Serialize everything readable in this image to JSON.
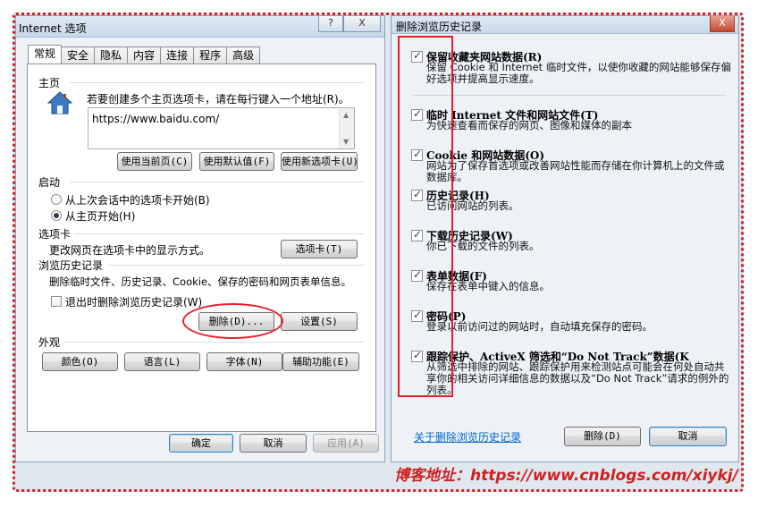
{
  "left": {
    "title": "Internet 选项",
    "help": "?",
    "close": "X",
    "tabs": [
      "常规",
      "安全",
      "隐私",
      "内容",
      "连接",
      "程序",
      "高级"
    ],
    "homepage": {
      "section": "主页",
      "hint": "若要创建多个主页选项卡，请在每行键入一个地址(R)。",
      "url": "https://www.baidu.com/",
      "btn_current": "使用当前页(C)",
      "btn_default": "使用默认值(F)",
      "btn_newtab": "使用新选项卡(U)"
    },
    "startup": {
      "section": "启动",
      "opt1": "从上次会话中的选项卡开始(B)",
      "opt2": "从主页开始(H)"
    },
    "tabsec": {
      "section": "选项卡",
      "hint": "更改网页在选项卡中的显示方式。",
      "btn": "选项卡(T)"
    },
    "history": {
      "section": "浏览历史记录",
      "hint": "删除临时文件、历史记录、Cookie、保存的密码和网页表单信息。",
      "checkbox": "退出时删除浏览历史记录(W)",
      "btn_delete": "删除(D)...",
      "btn_settings": "设置(S)"
    },
    "appearance": {
      "section": "外观",
      "btn_colors": "颜色(O)",
      "btn_lang": "语言(L)",
      "btn_fonts": "字体(N)",
      "btn_access": "辅助功能(E)"
    },
    "footer": {
      "ok": "确定",
      "cancel": "取消",
      "apply": "应用(A)"
    }
  },
  "right": {
    "title": "删除浏览历史记录",
    "close": "X",
    "items": [
      {
        "head": "保留收藏夹网站数据(R)",
        "desc": "保留 Cookie 和 Internet 临时文件，以使你收藏的网站能够保存偏好选项并提高显示速度。"
      },
      {
        "head": "临时 Internet 文件和网站文件(T)",
        "desc": "为快速查看而保存的网页、图像和媒体的副本"
      },
      {
        "head": "Cookie 和网站数据(O)",
        "desc": "网站为了保存首选项或改善网站性能而存储在你计算机上的文件或数据库。"
      },
      {
        "head": "历史记录(H)",
        "desc": "已访问网站的列表。"
      },
      {
        "head": "下载历史记录(W)",
        "desc": "你已下载的文件的列表。"
      },
      {
        "head": "表单数据(F)",
        "desc": "保存在表单中键入的信息。"
      },
      {
        "head": "密码(P)",
        "desc": "登录以前访问过的网站时，自动填充保存的密码。"
      },
      {
        "head": "跟踪保护、ActiveX 筛选和“Do Not Track”数据(K",
        "desc": "从筛选中排除的网站、跟踪保护用来检测站点可能会在何处自动共享你的相关访问详细信息的数据以及“Do Not Track”请求的例外的列表。"
      }
    ],
    "link": "关于删除浏览历史记录",
    "btn_delete": "删除(D)",
    "btn_cancel": "取消"
  },
  "watermark": "博客地址：https://www.cnblogs.com/xiykj/"
}
